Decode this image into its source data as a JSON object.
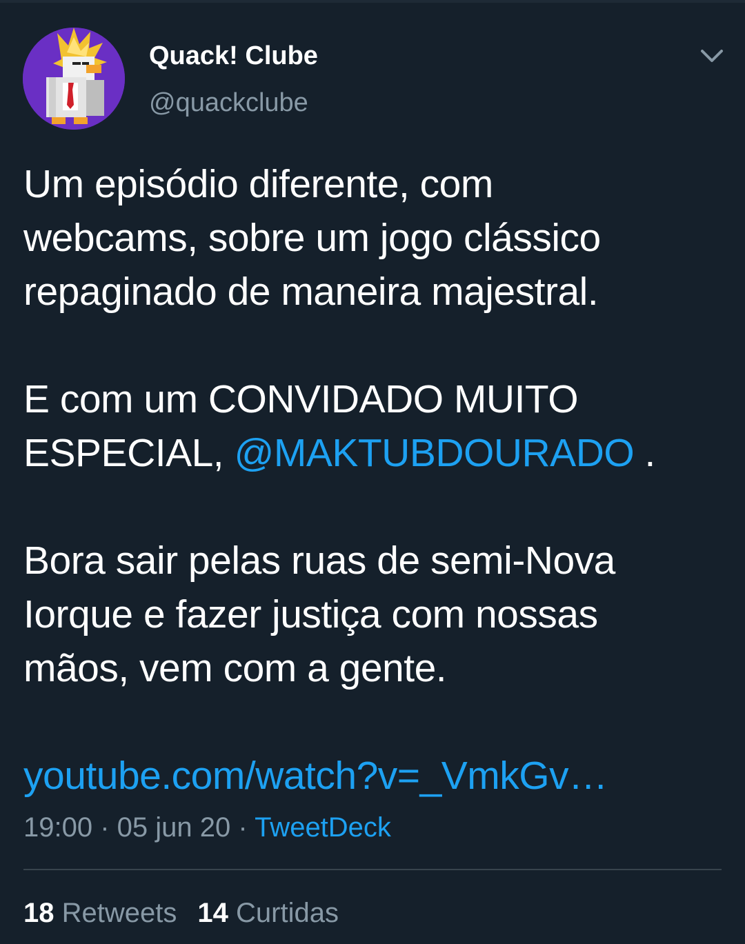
{
  "tweet": {
    "author": {
      "name": "Quack! Clube",
      "handle": "@quackclube"
    },
    "text": {
      "p1_lines": [
        "Um episódio diferente, com",
        "webcams, sobre um jogo clássico",
        "repaginado de maneira majestral."
      ],
      "p2_line1": "E com um CONVIDADO MUITO",
      "p2_line2_prefix": "ESPECIAL, ",
      "mention": "@MAKTUBDOURADO",
      "p2_line2_suffix": " .",
      "p3_lines": [
        "Bora sair pelas ruas de semi-Nova",
        "Iorque e fazer justiça com nossas",
        "mãos, vem com a gente."
      ],
      "link": "youtube.com/watch?v=_VmkGv…"
    },
    "meta": {
      "time": "19:00",
      "separator": " · ",
      "date": "05 jun 20",
      "source": "TweetDeck"
    },
    "stats": {
      "retweets_count": "18",
      "retweets_label": "Retweets",
      "likes_count": "14",
      "likes_label": "Curtidas"
    }
  },
  "colors": {
    "background": "#15202b",
    "accent": "#1da1f2",
    "secondary_text": "#8899a6",
    "divider": "#38444d",
    "avatar_background": "#6a2fc4"
  }
}
